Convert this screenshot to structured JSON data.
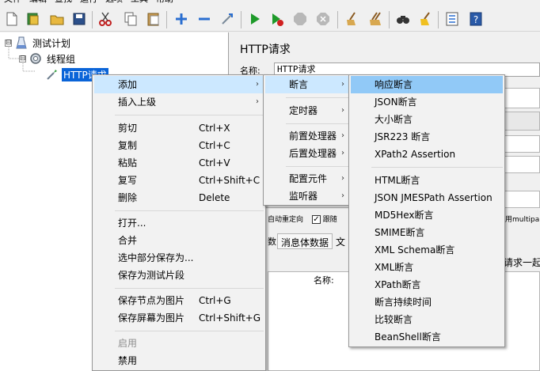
{
  "menubar": {
    "items": [
      "文件",
      "编辑",
      "查找",
      "运行",
      "选项",
      "工具",
      "帮助"
    ]
  },
  "toolbar": {
    "icons": [
      "new-icon",
      "templates-icon",
      "open-icon",
      "save-icon",
      "cut-icon",
      "copy-icon",
      "paste-icon",
      "expand-icon",
      "collapse-icon",
      "toggle-icon",
      "start-icon",
      "start-no-pause-icon",
      "stop-icon",
      "shutdown-icon",
      "clear-icon",
      "clear-all-icon",
      "search-icon",
      "reset-search-icon",
      "function-helper-icon",
      "help-icon"
    ]
  },
  "tree": {
    "root": {
      "expander": "⊟",
      "label": "测试计划"
    },
    "group": {
      "expander": "⊟",
      "label": "线程组"
    },
    "sampler": {
      "label": "HTTP请求"
    }
  },
  "right": {
    "title": "HTTP请求",
    "name_label": "名称:",
    "name_value": "HTTP请求",
    "redirect_text": "自动重定向",
    "follow_text": "跟随",
    "multipart_text": "用multipa",
    "tab_body": "消息体数据",
    "tab_file": "文",
    "tab_prefix": "数",
    "send_with": "请求一起",
    "col_name": "名称:"
  },
  "context_menu": {
    "items": [
      {
        "label": "添加",
        "arrow": "›"
      },
      {
        "label": "插入上级",
        "arrow": "›"
      },
      {
        "label": "剪切",
        "shortcut": "Ctrl+X"
      },
      {
        "label": "复制",
        "shortcut": "Ctrl+C"
      },
      {
        "label": "粘贴",
        "shortcut": "Ctrl+V"
      },
      {
        "label": "复写",
        "shortcut": "Ctrl+Shift+C"
      },
      {
        "label": "删除",
        "shortcut": "Delete"
      },
      {
        "label": "打开..."
      },
      {
        "label": "合并"
      },
      {
        "label": "选中部分保存为..."
      },
      {
        "label": "保存为测试片段"
      },
      {
        "label": "保存节点为图片",
        "shortcut": "Ctrl+G"
      },
      {
        "label": "保存屏幕为图片",
        "shortcut": "Ctrl+Shift+G"
      },
      {
        "label": "启用"
      },
      {
        "label": "禁用"
      }
    ]
  },
  "add_menu": {
    "items": [
      {
        "label": "断言",
        "arrow": "›"
      },
      {
        "label": "定时器",
        "arrow": "›"
      },
      {
        "label": "前置处理器",
        "arrow": "›"
      },
      {
        "label": "后置处理器",
        "arrow": "›"
      },
      {
        "label": "配置元件",
        "arrow": "›"
      },
      {
        "label": "监听器",
        "arrow": "›"
      }
    ]
  },
  "assert_menu": {
    "items": [
      {
        "label": "响应断言"
      },
      {
        "label": "JSON断言"
      },
      {
        "label": "大小断言"
      },
      {
        "label": "JSR223 断言"
      },
      {
        "label": "XPath2 Assertion"
      },
      {
        "label": "HTML断言"
      },
      {
        "label": "JSON JMESPath Assertion"
      },
      {
        "label": "MD5Hex断言"
      },
      {
        "label": "SMIME断言"
      },
      {
        "label": "XML Schema断言"
      },
      {
        "label": "XML断言"
      },
      {
        "label": "XPath断言"
      },
      {
        "label": "断言持续时间"
      },
      {
        "label": "比较断言"
      },
      {
        "label": "BeanShell断言"
      }
    ]
  },
  "colors": {
    "selection": "#0a64d8",
    "menu_highlight": "#91c9f7",
    "menu_bg": "#f2f2f2"
  }
}
